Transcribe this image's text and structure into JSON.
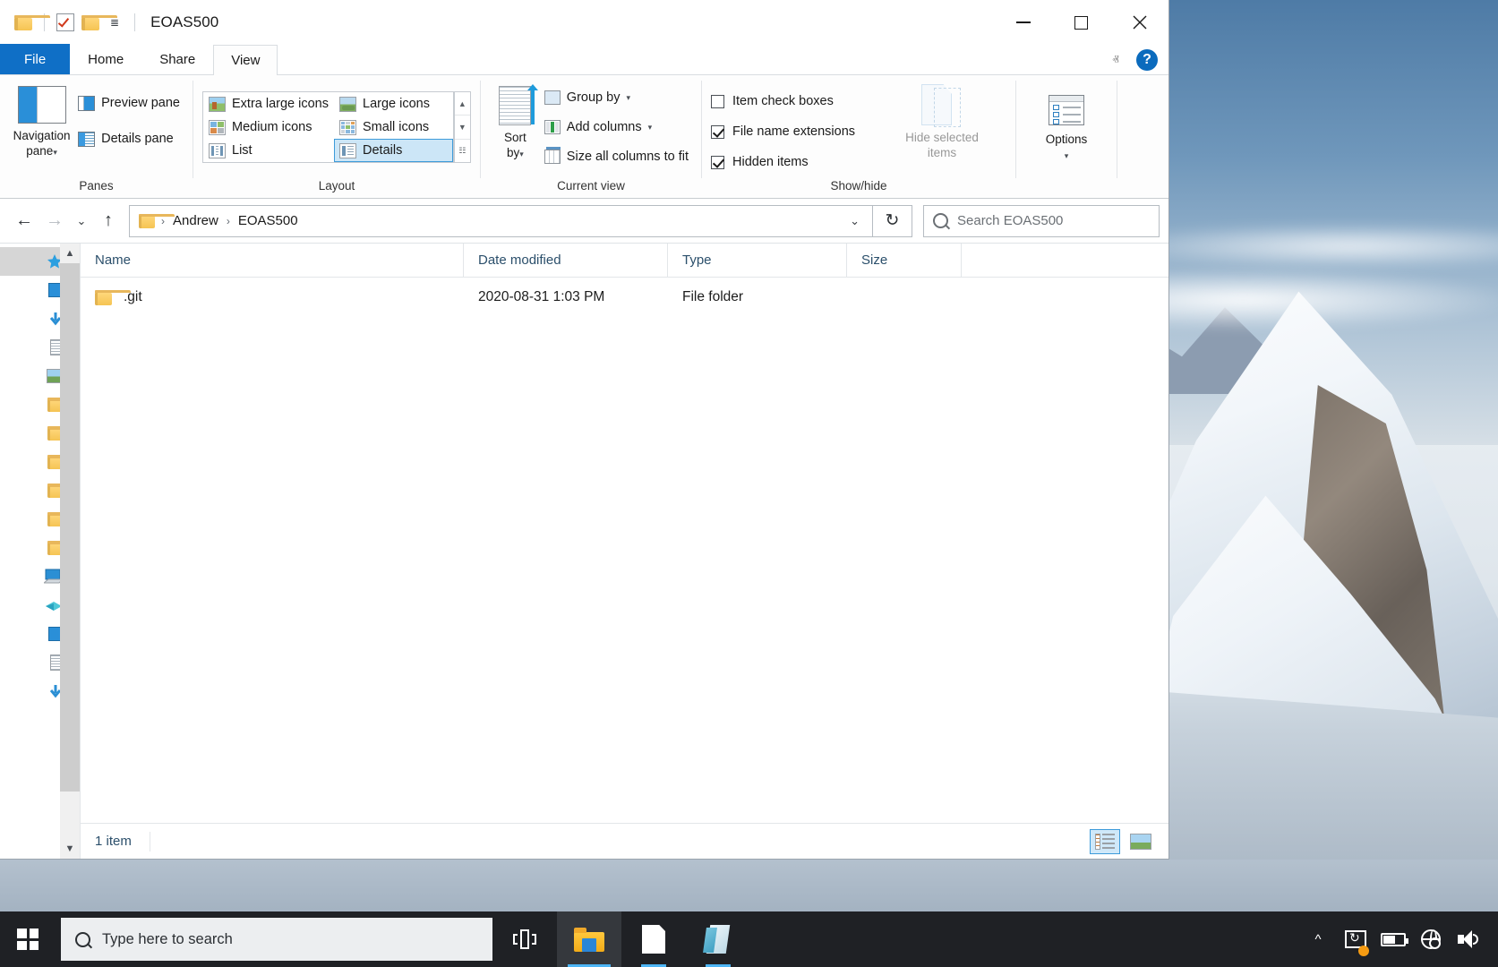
{
  "window": {
    "title": "EOAS500",
    "quick_access": [
      "folder-icon",
      "properties-icon",
      "new-folder-icon",
      "customize-dropdown"
    ],
    "controls": {
      "minimize": "—",
      "maximize": "□",
      "close": "✕"
    }
  },
  "ribbon": {
    "tabs": [
      {
        "label": "File",
        "active": false,
        "kind": "file"
      },
      {
        "label": "Home",
        "active": false,
        "kind": "normal"
      },
      {
        "label": "Share",
        "active": false,
        "kind": "normal"
      },
      {
        "label": "View",
        "active": true,
        "kind": "normal"
      }
    ],
    "collapse_label": "ⱏ",
    "help_label": "?",
    "groups": [
      {
        "name": "Panes",
        "label": "Panes",
        "navigation_pane": "Navigation\npane",
        "navigation_pane_l1": "Navigation",
        "navigation_pane_l2": "pane",
        "items": [
          {
            "label": "Preview pane",
            "checked": false
          },
          {
            "label": "Details pane",
            "checked": false
          }
        ]
      },
      {
        "name": "Layout",
        "label": "Layout",
        "gallery": [
          {
            "label": "Extra large icons",
            "selected": false
          },
          {
            "label": "Large icons",
            "selected": false
          },
          {
            "label": "Medium icons",
            "selected": false
          },
          {
            "label": "Small icons",
            "selected": false
          },
          {
            "label": "List",
            "selected": false
          },
          {
            "label": "Details",
            "selected": true
          }
        ],
        "scroll": [
          "▲",
          "▼",
          "☷"
        ]
      },
      {
        "name": "Current view",
        "label": "Current view",
        "sort_by_l1": "Sort",
        "sort_by_l2": "by",
        "items": [
          {
            "label": "Group by",
            "has_menu": true
          },
          {
            "label": "Add columns",
            "has_menu": true
          },
          {
            "label": "Size all columns to fit",
            "has_menu": false
          }
        ]
      },
      {
        "name": "Show/hide",
        "label": "Show/hide",
        "checkboxes": [
          {
            "label": "Item check boxes",
            "checked": false
          },
          {
            "label": "File name extensions",
            "checked": true
          },
          {
            "label": "Hidden items",
            "checked": true
          }
        ],
        "hide_selected_l1": "Hide selected",
        "hide_selected_l2": "items",
        "hide_selected_disabled": true
      },
      {
        "name": "Options",
        "label": "",
        "options_label": "Options"
      }
    ]
  },
  "address_bar": {
    "back": "←",
    "forward": "→",
    "recent": "⌄",
    "up": "↑",
    "breadcrumbs": [
      "Andrew",
      "EOAS500"
    ],
    "separator": "›",
    "dropdown": "⌄",
    "refresh": "↻",
    "search_placeholder": "Search EOAS500"
  },
  "file_list": {
    "columns": [
      {
        "key": "name",
        "label": "Name",
        "sorted": true,
        "sort_dir": "asc"
      },
      {
        "key": "date",
        "label": "Date modified",
        "sorted": false
      },
      {
        "key": "type",
        "label": "Type",
        "sorted": false
      },
      {
        "key": "size",
        "label": "Size",
        "sorted": false
      }
    ],
    "sort_indicator": "˄",
    "rows": [
      {
        "name": ".git",
        "date": "2020-08-31 1:03 PM",
        "type": "File folder",
        "size": "",
        "icon": "folder-icon"
      }
    ]
  },
  "status_bar": {
    "item_count": "1 item",
    "views": [
      {
        "name": "details-view",
        "active": true
      },
      {
        "name": "large-icons-view",
        "active": false
      }
    ]
  },
  "taskbar": {
    "start": "start-button",
    "search_placeholder": "Type here to search",
    "task_view": "task-view-button",
    "apps": [
      {
        "name": "file-explorer",
        "active": true
      },
      {
        "name": "notepad-document",
        "active": false,
        "open": true
      },
      {
        "name": "onenote-book",
        "active": false,
        "open": true
      }
    ],
    "tray": [
      {
        "name": "show-hidden-icons",
        "glyph": "ⱏ"
      },
      {
        "name": "onedrive-sync-icon",
        "badge": true
      },
      {
        "name": "battery-icon"
      },
      {
        "name": "network-disconnected-icon"
      },
      {
        "name": "volume-icon"
      }
    ]
  },
  "colors": {
    "accent": "#0f6fc6",
    "selection": "#cce6f7",
    "header_text": "#2b4f6b",
    "taskbar": "#1f2125",
    "badge": "#f59b12"
  }
}
